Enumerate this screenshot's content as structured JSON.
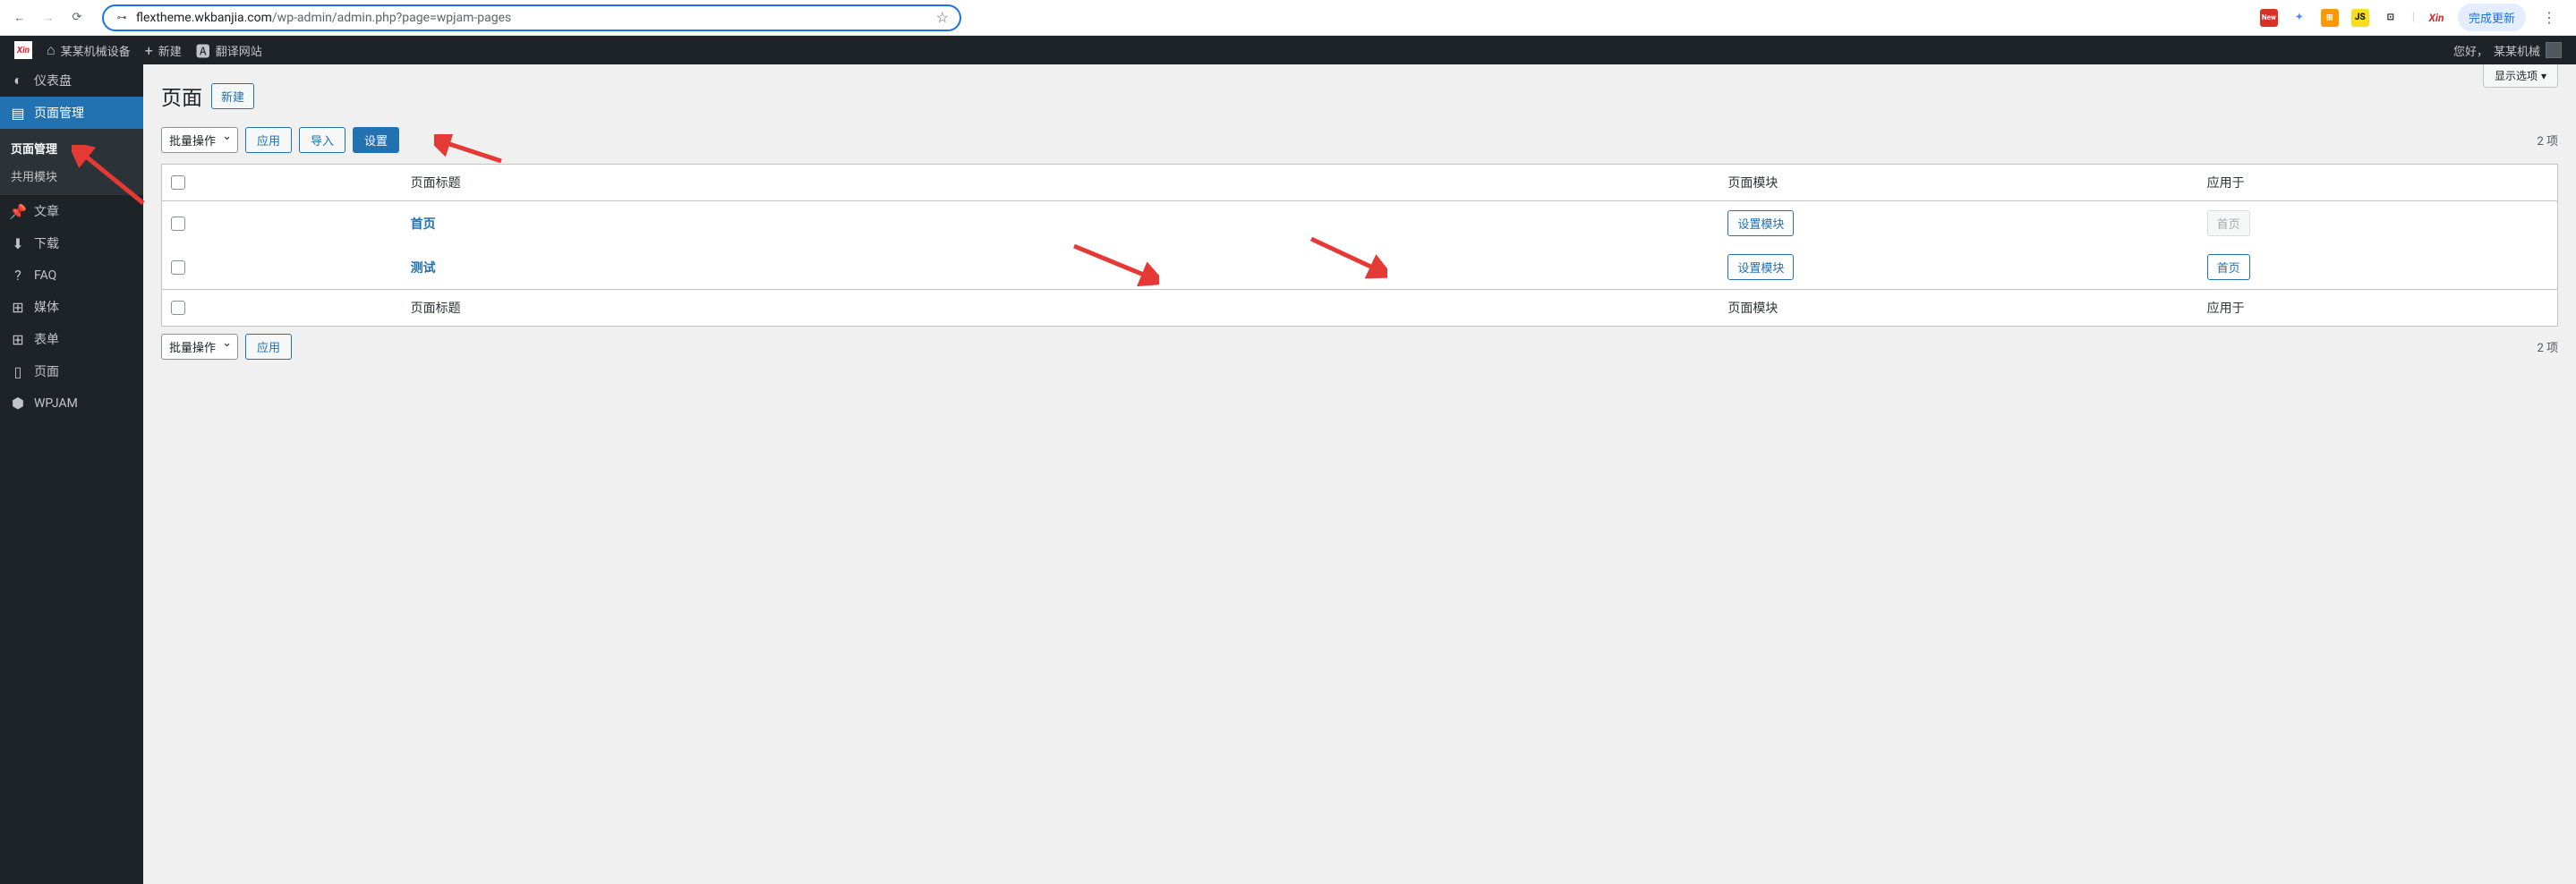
{
  "browser": {
    "url_host": "flextheme.wkbanjia.com",
    "url_path": "/wp-admin/admin.php?page=wpjam-pages",
    "update_btn": "完成更新"
  },
  "adminbar": {
    "site_name": "某某机械设备",
    "new": "新建",
    "translate": "翻译网站",
    "greeting": "您好，",
    "username": "某某机械"
  },
  "sidebar": {
    "items": [
      {
        "icon": "◐",
        "label": "仪表盘"
      },
      {
        "icon": "▤",
        "label": "页面管理"
      },
      {
        "icon": "📌",
        "label": "文章"
      },
      {
        "icon": "⬇",
        "label": "下载"
      },
      {
        "icon": "?",
        "label": "FAQ"
      },
      {
        "icon": "⊞",
        "label": "媒体"
      },
      {
        "icon": "⊞",
        "label": "表单"
      },
      {
        "icon": "▯",
        "label": "页面"
      },
      {
        "icon": "⬢",
        "label": "WPJAM"
      }
    ],
    "submenu": [
      {
        "label": "页面管理"
      },
      {
        "label": "共用模块"
      }
    ]
  },
  "main": {
    "screen_options": "显示选项",
    "page_title": "页面",
    "new_action": "新建",
    "bulk_select": "批量操作",
    "apply_btn": "应用",
    "import_btn": "导入",
    "settings_btn": "设置",
    "items_count": "2 项",
    "table": {
      "headers": {
        "title": "页面标题",
        "module": "页面模块",
        "apply": "应用于"
      },
      "rows": [
        {
          "title": "首页",
          "module_btn": "设置模块",
          "apply_btn": "首页",
          "apply_disabled": true
        },
        {
          "title": "测试",
          "module_btn": "设置模块",
          "apply_btn": "首页",
          "apply_disabled": false
        }
      ]
    }
  }
}
